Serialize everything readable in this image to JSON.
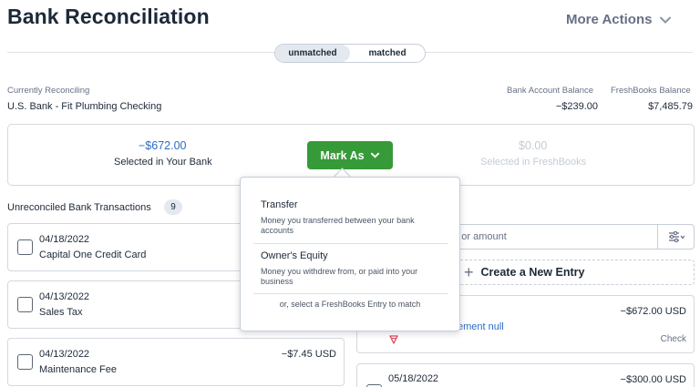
{
  "header": {
    "title": "Bank Reconciliation",
    "more_actions": "More Actions"
  },
  "view_toggle": {
    "options": [
      "unmatched",
      "matched"
    ],
    "selected": "unmatched"
  },
  "summary": {
    "currently_reconciling_label": "Currently Reconciling",
    "account_name": "U.S. Bank - Fit Plumbing Checking",
    "bank_balance_label": "Bank Account Balance",
    "bank_balance": "−$239.00",
    "freshbooks_balance_label": "FreshBooks Balance",
    "freshbooks_balance": "$7,485.79"
  },
  "selection": {
    "bank_amount": "−$672.00",
    "bank_label": "Selected in Your Bank",
    "freshbooks_amount": "$0.00",
    "freshbooks_label": "Selected in FreshBooks",
    "mark_as_label": "Mark As"
  },
  "mark_as_menu": {
    "items": [
      {
        "title": "Transfer",
        "description": "Money you transferred between your bank accounts"
      },
      {
        "title": "Owner's Equity",
        "description": "Money you withdrew from, or paid into your business"
      }
    ],
    "footer": "or, select a FreshBooks Entry to match"
  },
  "unreconciled": {
    "title": "Unreconciled Bank Transactions",
    "count": "9",
    "transactions": [
      {
        "date": "04/18/2022",
        "description": "Capital One Credit Card",
        "amount": ""
      },
      {
        "date": "04/13/2022",
        "description": "Sales Tax",
        "amount": ""
      },
      {
        "date": "04/13/2022",
        "description": "Maintenance Fee",
        "amount": "−$7.45 USD"
      }
    ]
  },
  "freshbooks_panel": {
    "search_placeholder": "try or amount",
    "create_entry_label": "Create a New Entry",
    "entries": [
      {
        "date": "",
        "amount": "−$672.00 USD",
        "link": "ement null",
        "type": "Check"
      },
      {
        "date": "05/18/2022",
        "amount": "−$300.00 USD",
        "link": "",
        "type": ""
      }
    ]
  },
  "colors": {
    "primary_green": "#379a38",
    "link_blue": "#2c6bc4",
    "text_dark": "#1d2939",
    "muted": "#667085"
  }
}
